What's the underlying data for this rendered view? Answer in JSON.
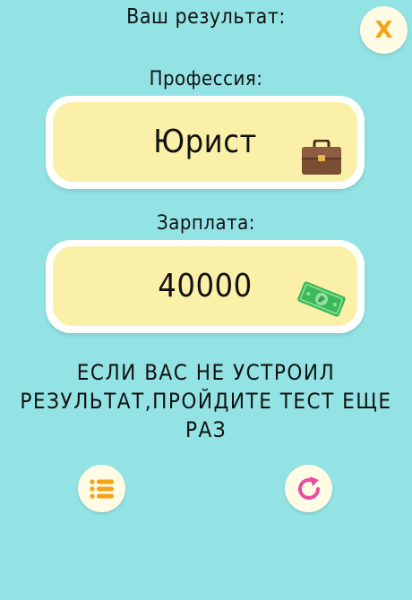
{
  "header": {
    "title": "Ваш результат:",
    "close_label": "X"
  },
  "profession": {
    "label": "Профессия:",
    "value": "Юрист",
    "icon": "briefcase-icon"
  },
  "salary": {
    "label": "Зарплата:",
    "value": "40000",
    "icon": "money-bill-icon"
  },
  "message": "Если вас не устроил результат,пройдите тест еще раз",
  "actions": {
    "list_icon": "list-icon",
    "retry_icon": "refresh-icon"
  },
  "colors": {
    "background": "#93e3e5",
    "card_fill": "#fbf0a8",
    "button_fill": "#fffbe5",
    "close_accent": "#f4a414",
    "list_accent": "#f4a414",
    "retry_accent": "#ea4ca2"
  }
}
